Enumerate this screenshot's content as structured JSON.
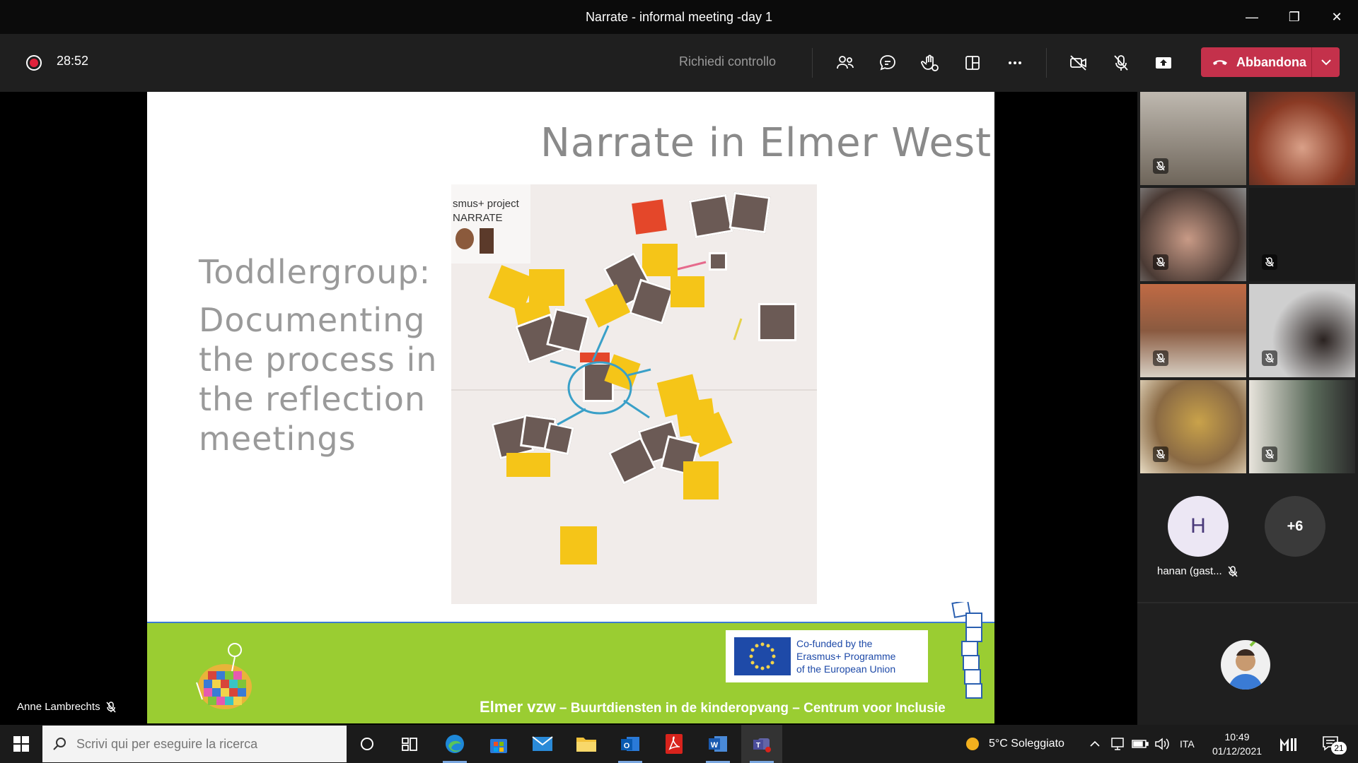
{
  "window": {
    "title": "Narrate - informal meeting -day 1",
    "controls": {
      "minimize": "—",
      "restore": "❐",
      "close": "✕"
    }
  },
  "toolbar": {
    "timer": "28:52",
    "request_control": "Richiedi controllo",
    "leave_label": "Abbandona",
    "leave_color": "#c4314b"
  },
  "slide": {
    "title": "Narrate in Elmer West",
    "subtitle": "Toddlergroup:",
    "body_lines": [
      "Documenting",
      "the process in",
      "the reflection",
      "meetings"
    ],
    "photo_label": [
      "smus+ project",
      "NARRATE"
    ],
    "eu_text": [
      "Co-funded by the",
      "Erasmus+ Programme",
      "of the European Union"
    ],
    "footer_main": "Elmer vzw",
    "footer_sub": "– Buurtdiensten in de kinderopvang – Centrum voor Inclusie",
    "footer_color": "#9acd32"
  },
  "presenter": {
    "name": "Anne Lambrechts"
  },
  "gallery": {
    "avatar_initial": "H",
    "more_count": "+6",
    "participant_name": "hanan (gast..."
  },
  "taskbar": {
    "search_placeholder": "Scrivi qui per eseguire la ricerca",
    "weather": "5°C  Soleggiato",
    "language": "ITA",
    "time": "10:49",
    "date": "01/12/2021",
    "notifications": "21"
  }
}
